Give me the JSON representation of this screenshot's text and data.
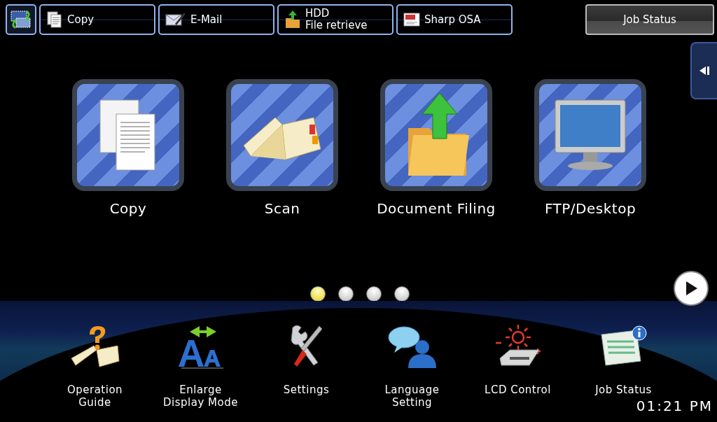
{
  "shortcut_bar": {
    "items": [
      {
        "kind": "copy",
        "lines": [
          "Copy"
        ]
      },
      {
        "kind": "email",
        "lines": [
          "E-Mail"
        ]
      },
      {
        "kind": "hdd",
        "lines": [
          "HDD",
          "File retrieve"
        ]
      },
      {
        "kind": "osa",
        "lines": [
          "Sharp OSA"
        ]
      }
    ]
  },
  "job_status_button": {
    "label": "Job Status"
  },
  "tiles": [
    {
      "kind": "copy",
      "label": "Copy"
    },
    {
      "kind": "scan",
      "label": "Scan"
    },
    {
      "kind": "filing",
      "label": "Document Filing"
    },
    {
      "kind": "desktop",
      "label": "FTP/Desktop"
    }
  ],
  "page_dots": [
    {
      "selected": true
    },
    {
      "selected": false
    },
    {
      "selected": false
    },
    {
      "selected": false
    }
  ],
  "bottom_items": [
    {
      "kind": "guide",
      "lines": [
        "Operation",
        "Guide"
      ]
    },
    {
      "kind": "enlarge",
      "lines": [
        "Enlarge",
        "Display Mode"
      ]
    },
    {
      "kind": "settings",
      "lines": [
        "Settings"
      ]
    },
    {
      "kind": "language",
      "lines": [
        "Language",
        "Setting"
      ]
    },
    {
      "kind": "lcd",
      "lines": [
        "LCD Control"
      ]
    },
    {
      "kind": "jobstatus",
      "lines": [
        "Job Status"
      ]
    }
  ],
  "clock": "01:21 PM"
}
